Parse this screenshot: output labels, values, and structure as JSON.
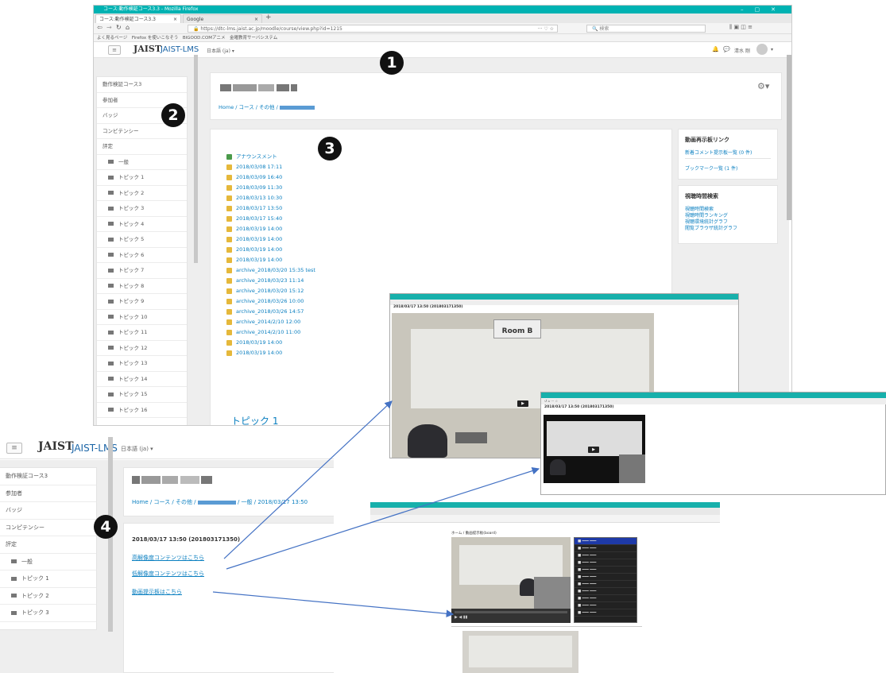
{
  "browser": {
    "window_title": "コース:動作検証コース3.3 - Mozilla Firefox",
    "tabs": [
      {
        "label": "コース:動作検証コース3.3"
      },
      {
        "label": "Google"
      }
    ],
    "new_tab": "+",
    "url": "https://dtc-lms.jaist.ac.jp/moodle/course/view.php?id=1215",
    "search_placeholder": "検索",
    "bookmarks": "よく見るページ　Firefox を使いこなそう　BIGOOD.COMアニメ　金曜教育サーバシステム"
  },
  "lms": {
    "logo_text": "JAIST",
    "site_name": "JAIST-LMS",
    "language": "日本語 (ja) ▾",
    "user_name": "清水 剛"
  },
  "drawer": {
    "items": [
      "動作検証コース3",
      "参加者",
      "バッジ",
      "コンピテンシー",
      "評定"
    ],
    "sections": [
      "一般",
      "トピック 1",
      "トピック 2",
      "トピック 3",
      "トピック 4",
      "トピック 5",
      "トピック 6",
      "トピック 7",
      "トピック 8",
      "トピック 9",
      "トピック 10",
      "トピック 11",
      "トピック 12",
      "トピック 13",
      "トピック 14",
      "トピック 15",
      "トピック 16"
    ]
  },
  "breadcrumb": "Home / コース / その他 / ",
  "course_items": [
    "アナウンスメント",
    "2018/03/08 17:11",
    "2018/03/09 16:40",
    "2018/03/09 11:30",
    "2018/03/13 10:30",
    "2018/03/17 13:50",
    "2018/03/17 15:40",
    "2018/03/19 14:00",
    "2018/03/19 14:00",
    "2018/03/19 14:00",
    "2018/03/19 14:00",
    "archive_2018/03/20 15:35 test",
    "archive_2018/03/23 11:14",
    "archive_2018/03/20 15:12",
    "archive_2018/03/26 10:00",
    "archive_2018/03/26 14:57",
    "archive_2014/2/10 12:00",
    "archive_2014/2/10 11:00",
    "2018/03/19 14:00",
    "2018/03/19 14:00"
  ],
  "topic_heading": "トピック 1",
  "blocks": {
    "video_links": {
      "title": "動画再示板リンク",
      "links": [
        "新着コメント提示板一覧 (0 件)",
        "ブックマーク一覧 (1 件)"
      ]
    },
    "viewing_search": {
      "title": "視聴時間検索",
      "links": [
        "視聴時間検索",
        "視聴時間ランキング",
        "視聴環境統計グラフ",
        "閲覧ブラウザ統計グラフ"
      ]
    }
  },
  "second": {
    "breadcrumb_pre": "Home / コース / その他 / ",
    "breadcrumb_post": " / 一般 / 2018/03/17 13:50",
    "drawer_items": [
      "動作検証コース3",
      "参加者",
      "バッジ",
      "コンピテンシー",
      "評定"
    ],
    "drawer_sections": [
      "一般",
      "トピック 1",
      "トピック 2",
      "トピック 3"
    ],
    "page_title": "2018/03/17 13:50 (201803171350)",
    "links": [
      "高解像度コンテンツはこちら",
      "低解像度コンテンツはこちら",
      "動画提示板はこちら"
    ]
  },
  "video_windows": {
    "hi_title": "2018/03/17 13:50 (201803171350)",
    "lo_title": "2018/03/17 13:50 (201803171350)",
    "room_sign": "Room B",
    "board_title": "ホーム / 動画提示板(board)"
  },
  "markers": [
    "1",
    "2",
    "3",
    "4"
  ],
  "colors": {
    "accent": "#0a7fc0",
    "titlebar": "#00b2b2",
    "arrow": "#4472c4"
  }
}
